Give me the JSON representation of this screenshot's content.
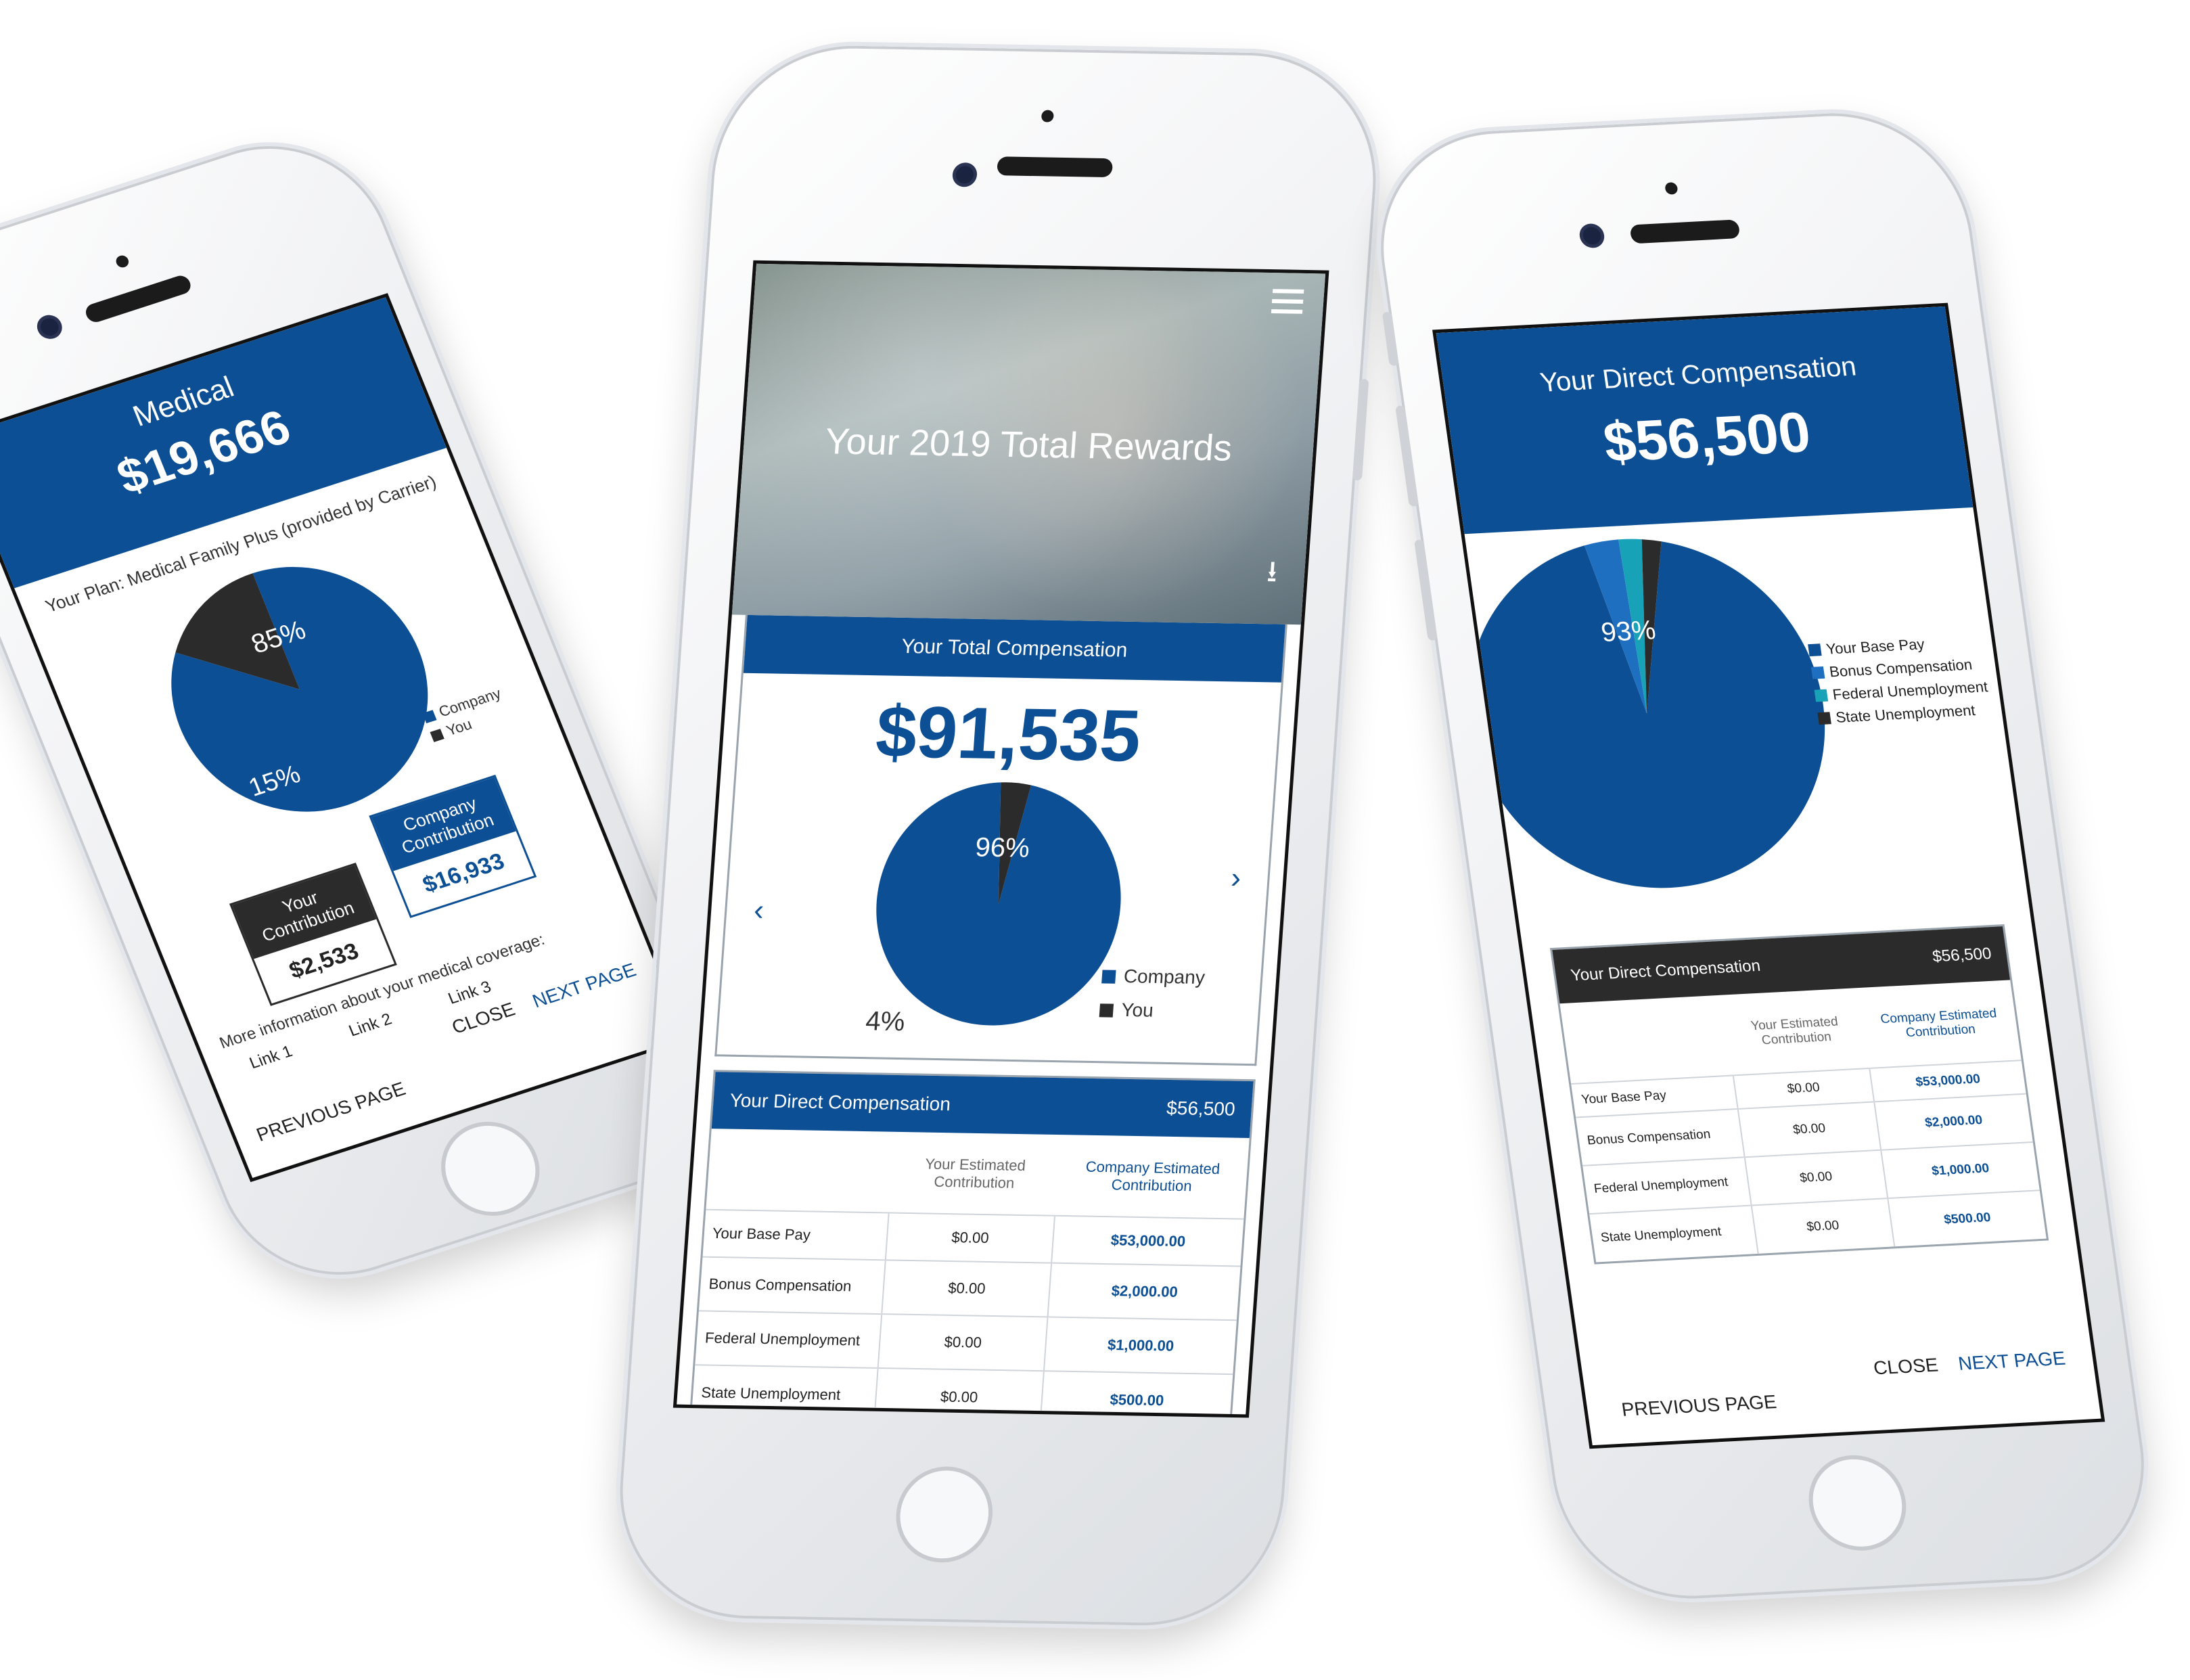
{
  "phone_left": {
    "title": "Medical",
    "amount": "$19,666",
    "plan": "Your Plan: Medical Family Plus (provided by Carrier)",
    "pie": {
      "company_pct": "85%",
      "you_pct": "15%",
      "company_fraction": 0.85
    },
    "legend": [
      "Company",
      "You"
    ],
    "your_contribution_label": "Your Contribution",
    "your_contribution_value": "$2,533",
    "company_contribution_label": "Company Contribution",
    "company_contribution_value": "$16,933",
    "more_info": "More information about your medical coverage:",
    "links": [
      "Link 1",
      "Link 2",
      "Link 3"
    ],
    "close": "CLOSE",
    "next": "NEXT PAGE",
    "previous": "PREVIOUS PAGE"
  },
  "phone_center": {
    "hero_title": "Your 2019 Total Rewards",
    "total_comp_label": "Your Total Compensation",
    "total_comp_value": "$91,535",
    "pie": {
      "company_pct": "96%",
      "you_pct": "4%",
      "company_fraction": 0.96
    },
    "legend": [
      "Company",
      "You"
    ],
    "table_title": "Your Direct Compensation",
    "table_total": "$56,500",
    "col_headers": [
      "Your Estimated Contribution",
      "Company Estimated Contribution"
    ],
    "rows": [
      {
        "label": "Your Base Pay",
        "you": "$0.00",
        "company": "$53,000.00"
      },
      {
        "label": "Bonus Compensation",
        "you": "$0.00",
        "company": "$2,000.00"
      },
      {
        "label": "Federal Unemployment",
        "you": "$0.00",
        "company": "$1,000.00"
      },
      {
        "label": "State Unemployment",
        "you": "$0.00",
        "company": "$500.00"
      }
    ]
  },
  "phone_right": {
    "title": "Your Direct Compensation",
    "amount": "$56,500",
    "pie": {
      "main_pct": "93%",
      "main_fraction": 0.93
    },
    "legend": [
      "Your Base Pay",
      "Bonus Compensation",
      "Federal Unemployment",
      "State Unemployment"
    ],
    "table_title": "Your Direct Compensation",
    "table_total": "$56,500",
    "col_headers": [
      "Your Estimated Contribution",
      "Company Estimated Contribution"
    ],
    "rows": [
      {
        "label": "Your Base Pay",
        "you": "$0.00",
        "company": "$53,000.00"
      },
      {
        "label": "Bonus Compensation",
        "you": "$0.00",
        "company": "$2,000.00"
      },
      {
        "label": "Federal Unemployment",
        "you": "$0.00",
        "company": "$1,000.00"
      },
      {
        "label": "State Unemployment",
        "you": "$0.00",
        "company": "$500.00"
      }
    ],
    "close": "CLOSE",
    "next": "NEXT PAGE",
    "previous": "PREVIOUS PAGE"
  },
  "colors": {
    "brand_blue": "#0d4f94",
    "dark": "#2b2b2b",
    "teal": "#17a2b8",
    "mid_blue": "#1f6fc1"
  }
}
